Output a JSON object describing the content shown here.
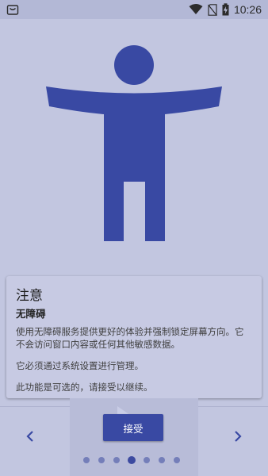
{
  "status_bar": {
    "time": "10:26",
    "icons": [
      "notification-bag-icon",
      "wifi-icon",
      "no-sim-icon",
      "battery-charging-icon"
    ]
  },
  "hero": {
    "icon": "accessibility-person-icon"
  },
  "card": {
    "title": "注意",
    "subtitle": "无障碍",
    "paragraph1": "使用无障碍服务提供更好的体验并强制锁定屏幕方向。它不会访问窗口内容或任何其他敏感数据。",
    "paragraph2": "它必须通过系统设置进行管理。",
    "paragraph3": "此功能是可选的，请接受以继续。"
  },
  "actions": {
    "accept_label": "接受"
  },
  "pager": {
    "total_pages": 7,
    "current_page": 4
  },
  "colors": {
    "accent": "#3949a3",
    "background": "#c2c6e0"
  }
}
